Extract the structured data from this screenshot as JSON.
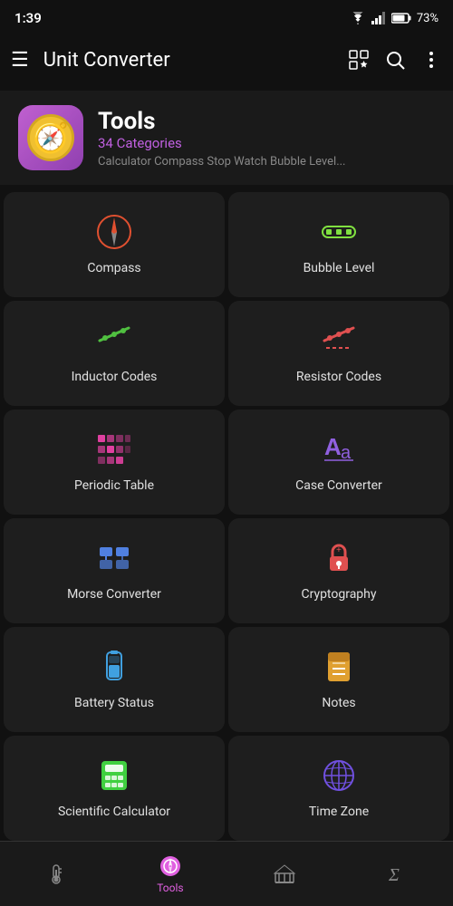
{
  "statusBar": {
    "time": "1:39",
    "battery": "73%"
  },
  "appBar": {
    "menuLabel": "☰",
    "title": "Unit Converter"
  },
  "header": {
    "title": "Tools",
    "subtitle": "34 Categories",
    "description": "Calculator Compass Stop Watch Bubble Level..."
  },
  "grid": {
    "items": [
      {
        "id": "compass",
        "label": "Compass",
        "color": "#e05030"
      },
      {
        "id": "bubble-level",
        "label": "Bubble Level",
        "color": "#80e040"
      },
      {
        "id": "inductor-codes",
        "label": "Inductor Codes",
        "color": "#50c040"
      },
      {
        "id": "resistor-codes",
        "label": "Resistor Codes",
        "color": "#e05050"
      },
      {
        "id": "periodic-table",
        "label": "Periodic Table",
        "color": "#e040a0"
      },
      {
        "id": "case-converter",
        "label": "Case Converter",
        "color": "#9060e0"
      },
      {
        "id": "morse-converter",
        "label": "Morse Converter",
        "color": "#5080e0"
      },
      {
        "id": "cryptography",
        "label": "Cryptography",
        "color": "#e05050"
      },
      {
        "id": "battery-status",
        "label": "Battery Status",
        "color": "#40a0e0"
      },
      {
        "id": "notes",
        "label": "Notes",
        "color": "#e0a030"
      },
      {
        "id": "scientific-calculator",
        "label": "Scientific Calculator",
        "color": "#40d040"
      },
      {
        "id": "time-zone",
        "label": "Time Zone",
        "color": "#7050e0"
      }
    ]
  },
  "bottomNav": {
    "items": [
      {
        "id": "temperature",
        "label": "",
        "icon": "thermometer",
        "active": false
      },
      {
        "id": "tools",
        "label": "Tools",
        "icon": "compass",
        "active": true
      },
      {
        "id": "converter",
        "label": "",
        "icon": "bank",
        "active": false
      },
      {
        "id": "math",
        "label": "",
        "icon": "sigma",
        "active": false
      }
    ]
  }
}
